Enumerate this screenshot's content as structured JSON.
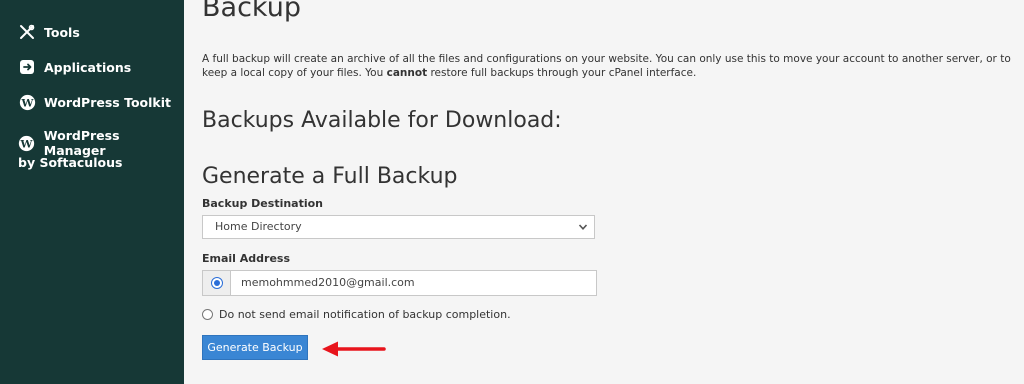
{
  "sidebar": {
    "items": [
      {
        "label": "Tools",
        "icon": "tools-icon"
      },
      {
        "label": "Applications",
        "icon": "applications-icon"
      },
      {
        "label": "WordPress Toolkit",
        "icon": "wordpress-icon"
      },
      {
        "label": "WordPress Manager",
        "icon": "wordpress-icon"
      }
    ],
    "sub_label": "by Softaculous"
  },
  "page": {
    "title": "Backup",
    "desc_part1": "A full backup will create an archive of all the files and configurations on your website. You can only use this to move your account to another server, or to keep a local copy of your files. You ",
    "desc_bold": "cannot",
    "desc_part2": " restore full backups through your cPanel interface.",
    "available_heading": "Backups Available for Download:",
    "generate_heading": "Generate a Full Backup"
  },
  "form": {
    "destination_label": "Backup Destination",
    "destination_value": "Home Directory",
    "email_label": "Email Address",
    "email_value": "memohmmed2010@gmail.com",
    "no_email_option": "Do not send email notification of backup completion.",
    "generate_button": "Generate Backup"
  },
  "colors": {
    "sidebar_bg": "#163836",
    "button_bg": "#3a86d4",
    "arrow": "#e8141c"
  }
}
